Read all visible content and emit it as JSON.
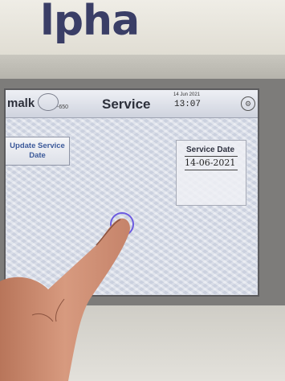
{
  "device": {
    "logo_text": "lpha"
  },
  "screen": {
    "brand": "malk",
    "model": "-650",
    "title": "Service",
    "date_small": "14 Jun 2021",
    "time": "13:07",
    "update_button_label": "Update Service Date",
    "service_date_label": "Service Date",
    "service_date_value": "14-06-2021",
    "settings_icon": "gear-icon"
  },
  "colors": {
    "logo": "#3a3e66",
    "update_button_text": "#3c5a9a",
    "touch_indicator": "#6c5be0"
  }
}
